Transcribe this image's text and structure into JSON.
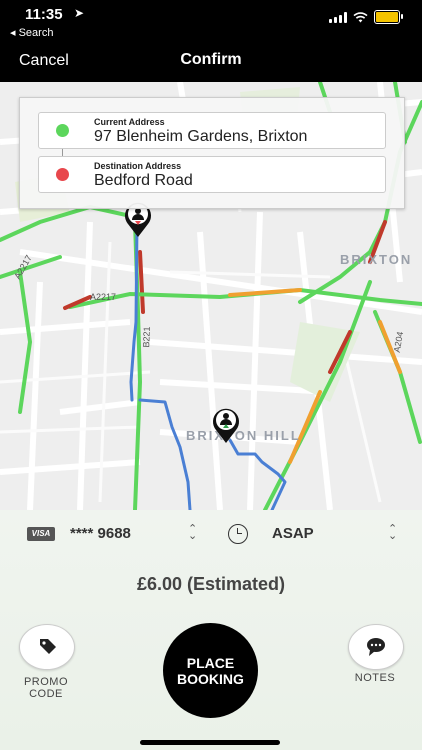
{
  "status_bar": {
    "time": "11:35",
    "back_label": "◂ Search"
  },
  "nav": {
    "cancel_label": "Cancel",
    "title": "Confirm"
  },
  "addresses": {
    "current": {
      "label": "Current Address",
      "value": "97 Blenheim Gardens, Brixton"
    },
    "destination": {
      "label": "Destination Address",
      "value": "Bedford Road"
    }
  },
  "map": {
    "area_labels": [
      "BRIXTON",
      "BRIXTON HILL"
    ],
    "road_labels": [
      "A2217",
      "A2217",
      "B221",
      "A204"
    ]
  },
  "payment": {
    "card_brand": "VISA",
    "card_number": "**** 9688",
    "time_option": "ASAP"
  },
  "price": "£6.00 (Estimated)",
  "actions": {
    "promo_label_line1": "PROMO",
    "promo_label_line2": "CODE",
    "place_line1": "PLACE",
    "place_line2": "BOOKING",
    "notes_label": "NOTES"
  },
  "colors": {
    "accent_green": "#5cd65c",
    "accent_red": "#e8474c",
    "route_blue": "#4a7fd4"
  }
}
